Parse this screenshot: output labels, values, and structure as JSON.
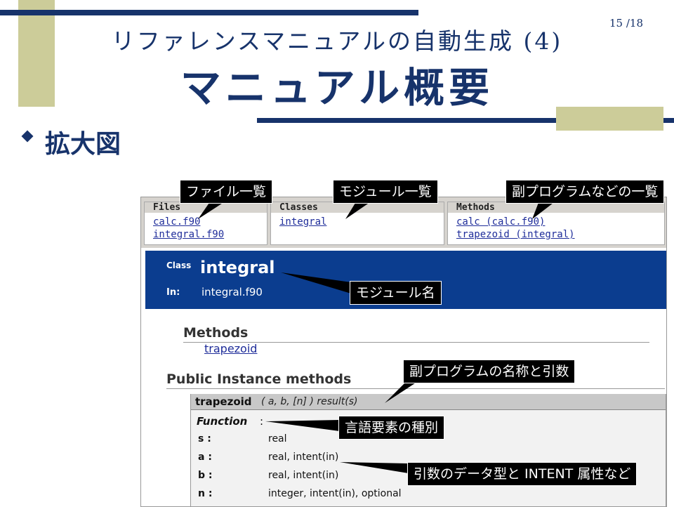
{
  "slide": {
    "page_number": "15 /18",
    "title_line1": "リファレンスマニュアルの自動生成 (4)",
    "title_line2": "マニュアル概要",
    "bullet": "拡大図"
  },
  "colors": {
    "navy": "#17336b",
    "olive": "#cccc99",
    "class_bar": "#0b3d8f"
  },
  "screenshot": {
    "frames": [
      {
        "header": "Files",
        "links": [
          "calc.f90",
          "integral.f90"
        ]
      },
      {
        "header": "Classes",
        "links": [
          "integral"
        ]
      },
      {
        "header": "Methods",
        "links": [
          "calc (calc.f90)",
          "trapezoid (integral)"
        ]
      }
    ],
    "class_label": "Class",
    "class_name": "integral",
    "in_label": "In:",
    "in_value": "integral.f90",
    "methods_heading": "Methods",
    "methods_link": "trapezoid",
    "public_heading": "Public Instance methods",
    "signature_name": "trapezoid",
    "signature_args": "( a, b, [n] ) result(s)",
    "function_label": "Function",
    "function_colon": ":",
    "params": [
      {
        "name": "s :",
        "type": "real"
      },
      {
        "name": "a :",
        "type": "real, intent(in)"
      },
      {
        "name": "b :",
        "type": "real, intent(in)"
      },
      {
        "name": "n :",
        "type": "integer, intent(in), optional"
      }
    ]
  },
  "callouts": {
    "files": "ファイル一覧",
    "modules": "モジュール一覧",
    "subprograms": "副プログラムなどの一覧",
    "module_name": "モジュール名",
    "name_args": "副プログラムの名称と引数",
    "element_kind": "言語要素の種別",
    "datatype_intent": "引数のデータ型と INTENT 属性など"
  }
}
